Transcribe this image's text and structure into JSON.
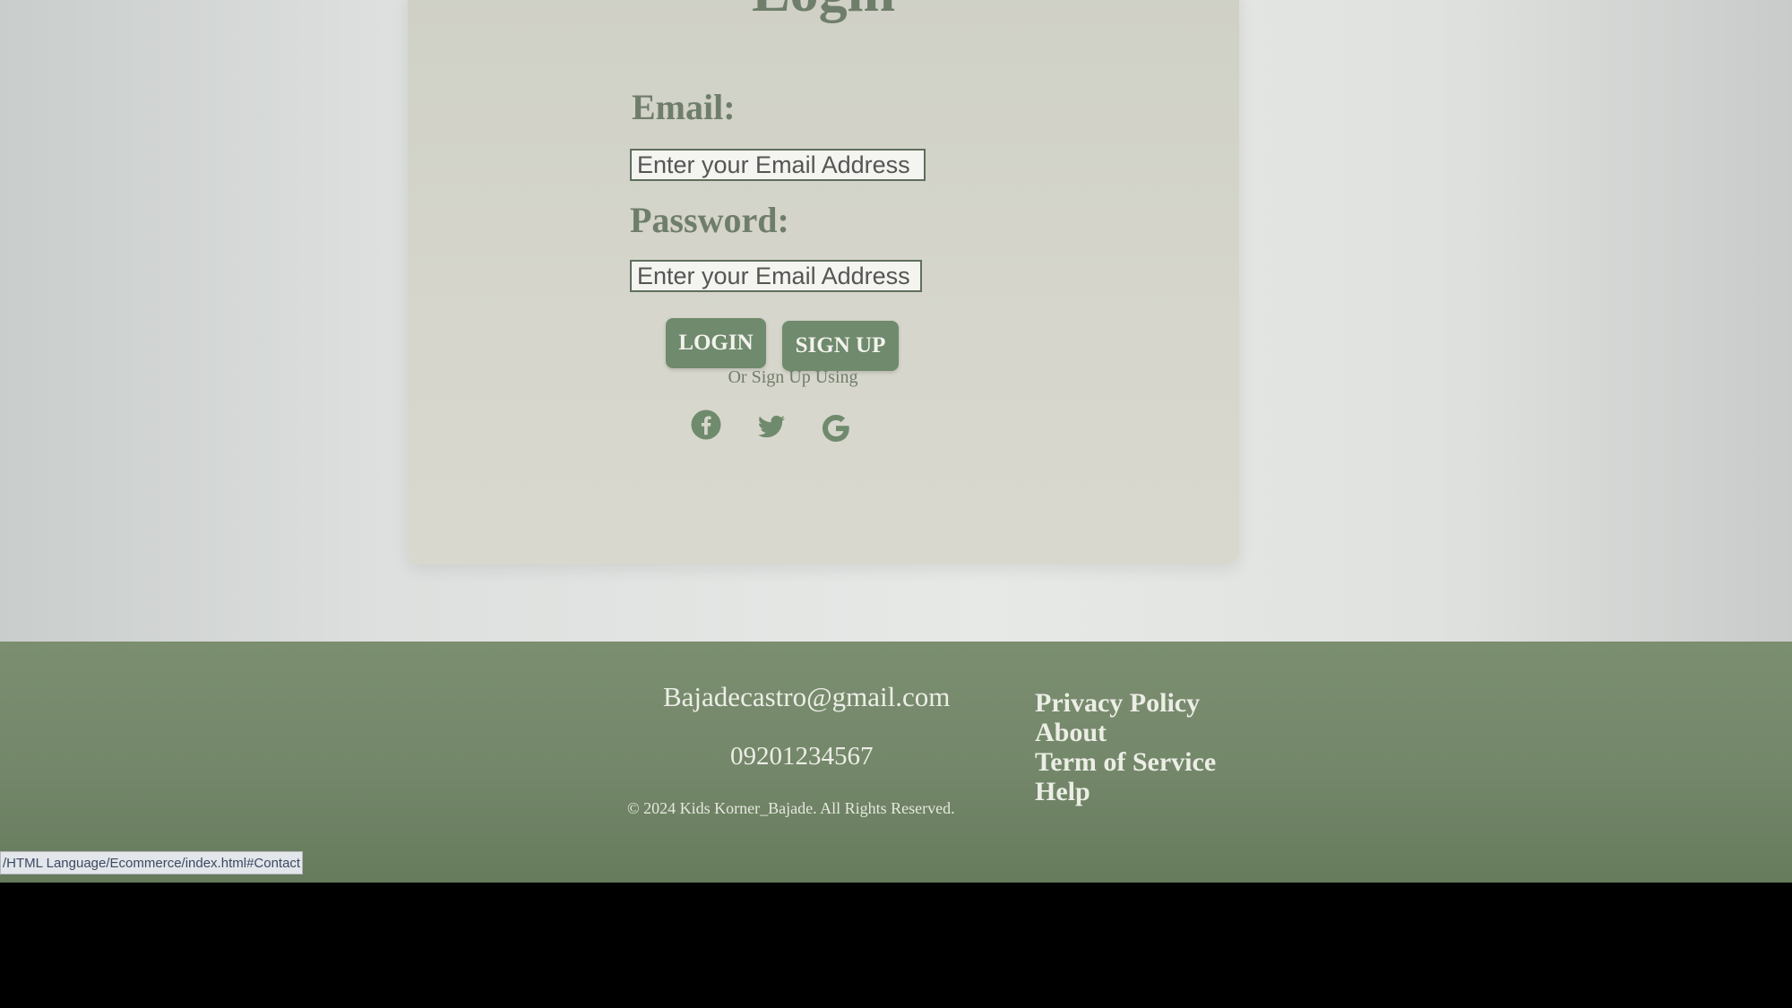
{
  "login_card": {
    "title": "Login",
    "email_label": "Email:",
    "email_placeholder": "Enter your Email Address",
    "password_label": "Password:",
    "password_placeholder": "Enter your Email Address",
    "login_button": "LOGIN",
    "signup_button": "SIGN UP",
    "social_prompt": "Or Sign Up Using",
    "social_icons": [
      "facebook-icon",
      "twitter-icon",
      "google-icon"
    ]
  },
  "footer": {
    "email": "Bajadecastro@gmail.com",
    "phone": "09201234567",
    "copyright": "© 2024 Kids Korner_Bajade. All Rights Reserved.",
    "links": [
      "Privacy Policy",
      "About",
      "Term of Service",
      "Help"
    ]
  },
  "status_bar": {
    "url": "/HTML Language/Ecommerce/index.html#Contact"
  },
  "colors": {
    "accent": "#6f8a6c",
    "footer_bg": "#74876a",
    "heading": "#6f7e6b"
  }
}
